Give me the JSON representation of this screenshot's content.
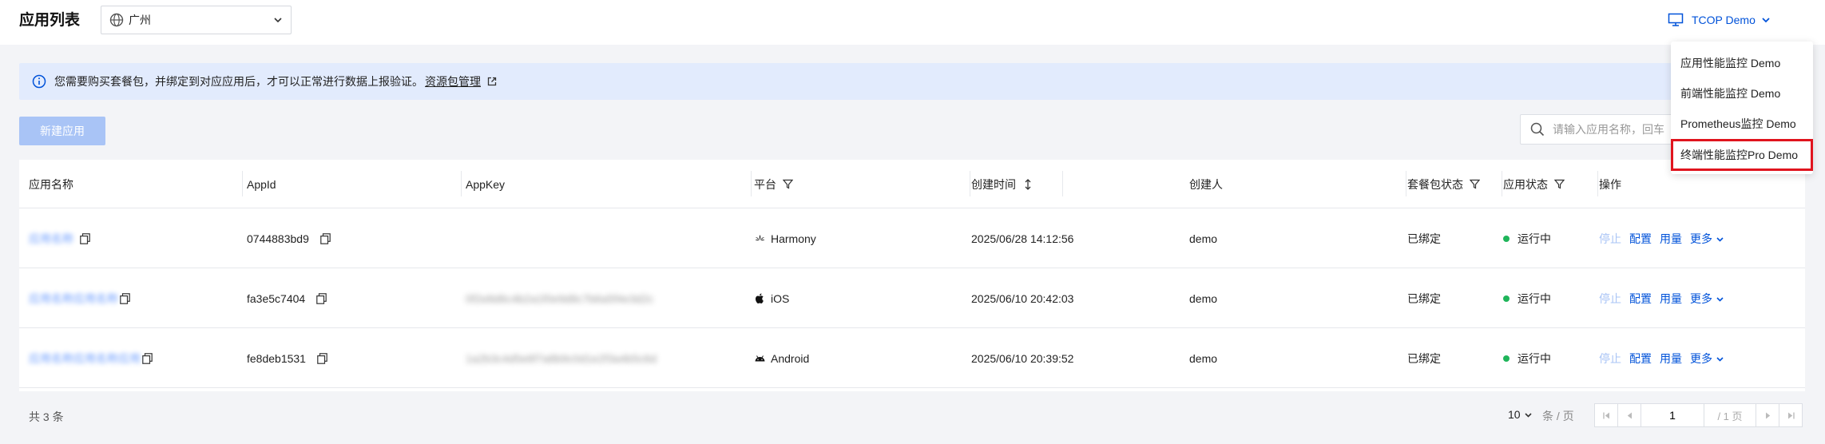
{
  "header": {
    "title": "应用列表",
    "region": "广州",
    "demo_switch": "TCOP Demo"
  },
  "dropdown": {
    "items": [
      {
        "label": "应用性能监控 Demo"
      },
      {
        "label": "前端性能监控 Demo"
      },
      {
        "label": "Prometheus监控 Demo"
      },
      {
        "label": "终端性能监控Pro Demo"
      }
    ]
  },
  "banner": {
    "text": "您需要购买套餐包，并绑定到对应应用后，才可以正常进行数据上报验证。",
    "link": "资源包管理"
  },
  "toolbar": {
    "new_app": "新建应用",
    "search_placeholder": "请输入应用名称，回车"
  },
  "table": {
    "columns": {
      "name": "应用名称",
      "appid": "AppId",
      "appkey": "AppKey",
      "platform": "平台",
      "created": "创建时间",
      "creator": "创建人",
      "package": "套餐包状态",
      "status": "应用状态",
      "ops": "操作"
    },
    "rows": [
      {
        "name": "应用名称",
        "appid": "0744883bd9",
        "appkey": "",
        "platform": "Harmony",
        "created": "2025/06/28 14:12:56",
        "creator": "demo",
        "package": "已绑定",
        "status": "运行中"
      },
      {
        "name": "应用名称应用名称",
        "appid": "fa3e5c7404",
        "appkey": "0f2e8d6c4b2a1f0e9d8c7b6a5f4e3d2c",
        "platform": "iOS",
        "created": "2025/06/10 20:42:03",
        "creator": "demo",
        "package": "已绑定",
        "status": "运行中"
      },
      {
        "name": "应用名称应用名称应用",
        "appid": "fe8deb1531",
        "appkey": "1a2b3c4d5e6f7a8b9c0d1e2f3a4b5c6d",
        "platform": "Android",
        "created": "2025/06/10 20:39:52",
        "creator": "demo",
        "package": "已绑定",
        "status": "运行中"
      }
    ],
    "ops": {
      "stop": "停止",
      "config": "配置",
      "usage": "用量",
      "more": "更多"
    }
  },
  "footer": {
    "total": "共 3 条",
    "page_size": "10",
    "per_page": "条 / 页",
    "page": "1",
    "total_pages": "/ 1 页"
  }
}
